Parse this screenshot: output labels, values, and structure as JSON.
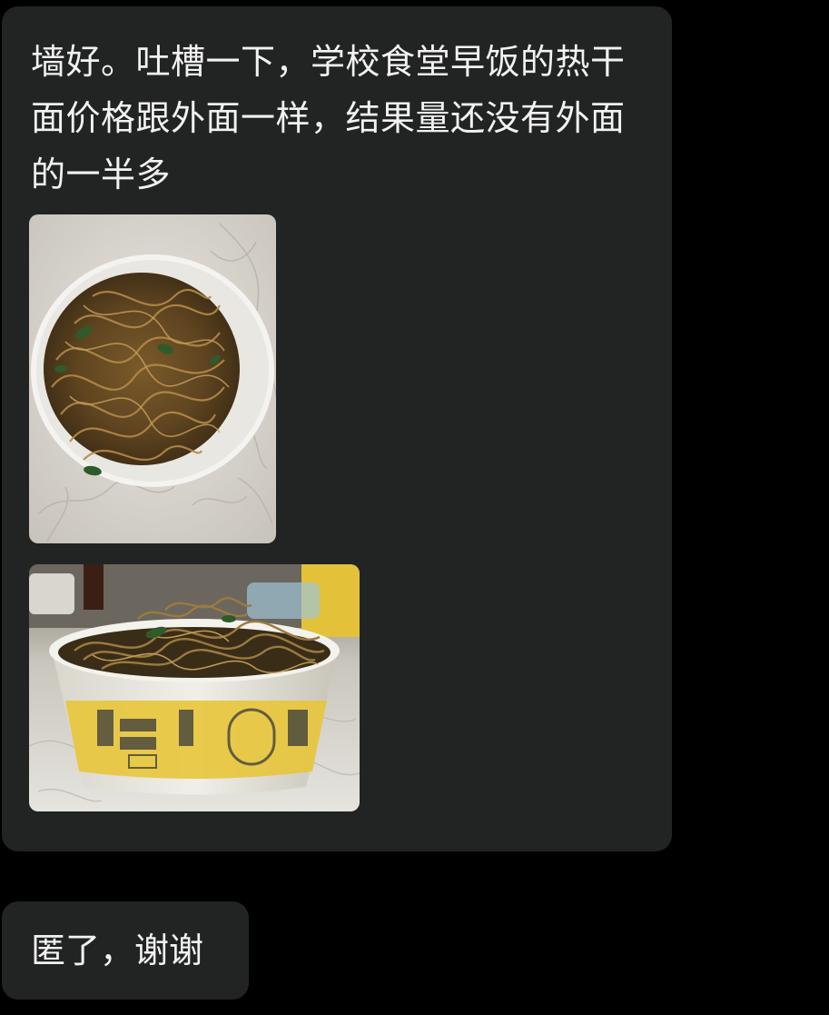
{
  "messages": [
    {
      "text": "墙好。吐槽一下，学校食堂早饭的热干面价格跟外面一样，结果量还没有外面的一半多",
      "images": [
        {
          "icon": "noodle-bowl-photo"
        },
        {
          "icon": "paper-bowl-noodle-photo"
        }
      ]
    },
    {
      "text": "匿了，谢谢"
    }
  ],
  "colors": {
    "background": "#000000",
    "bubble": "#222423",
    "text": "#f2f2f2"
  }
}
